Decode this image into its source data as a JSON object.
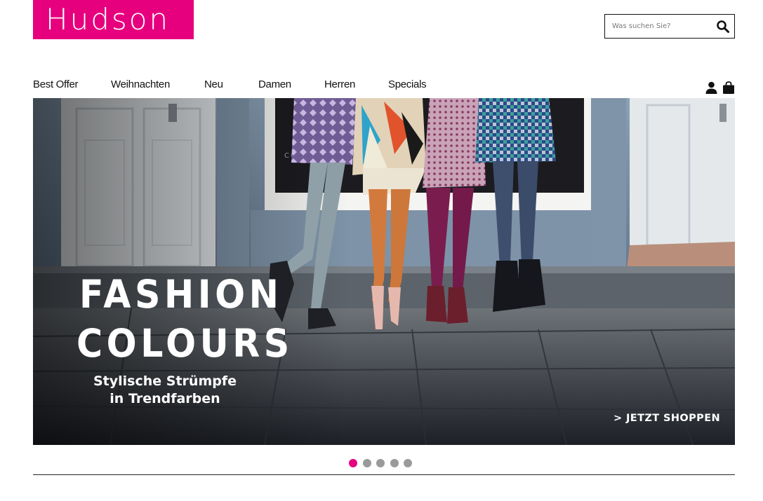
{
  "brand": {
    "logo_text": "Hudson",
    "accent_color": "#e6007e"
  },
  "search": {
    "placeholder": "Was suchen Sie?",
    "icon": "search-icon"
  },
  "nav": {
    "items": [
      {
        "label": "Best Offer"
      },
      {
        "label": "Weihnachten"
      },
      {
        "label": "Neu"
      },
      {
        "label": "Damen"
      },
      {
        "label": "Herren"
      },
      {
        "label": "Specials"
      }
    ],
    "icons": [
      "user-icon",
      "shopping-bag-icon"
    ]
  },
  "hero": {
    "headline_line1": "FASHION",
    "headline_line2": "COLOURS",
    "subline_line1": "Stylische Strümpfe",
    "subline_line2": "in Trendfarben",
    "cta": "> JETZT SHOPPEN",
    "shop_window_text": "COMIN"
  },
  "carousel": {
    "slide_count": 5,
    "active_index": 1,
    "active_color": "#e6007e",
    "inactive_color": "#9a9a9a"
  }
}
